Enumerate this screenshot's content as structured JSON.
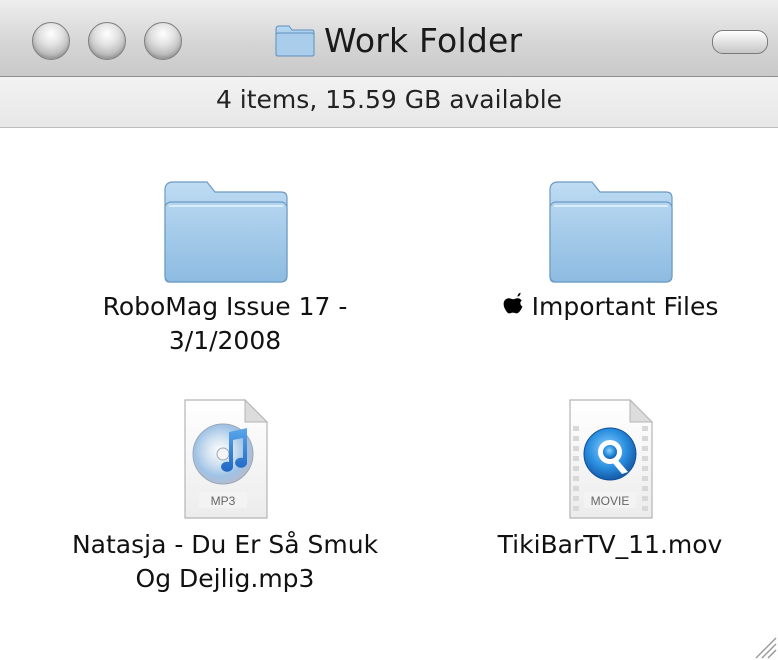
{
  "window": {
    "title": "Work Folder"
  },
  "status": {
    "text": "4 items, 15.59 GB available"
  },
  "items": [
    {
      "kind": "folder",
      "label_line1": "RoboMag Issue 17 -",
      "label_line2": "3/1/2008",
      "icon": "folder-icon"
    },
    {
      "kind": "folder",
      "label": "Important Files",
      "badge_icon": "apple-logo-icon",
      "icon": "folder-icon"
    },
    {
      "kind": "mp3",
      "label_line1": "Natasja - Du Er Så Smuk",
      "label_line2": "Og Dejlig.mp3",
      "icon": "mp3-file-icon",
      "icon_caption": "MP3"
    },
    {
      "kind": "movie",
      "label": "TikiBarTV_11.mov",
      "icon": "quicktime-movie-icon",
      "icon_caption": "MOVIE"
    }
  ],
  "colors": {
    "folder_blue": "#8fbce3",
    "titlebar_top": "#eeeeee",
    "titlebar_bottom": "#c9c9c9"
  }
}
